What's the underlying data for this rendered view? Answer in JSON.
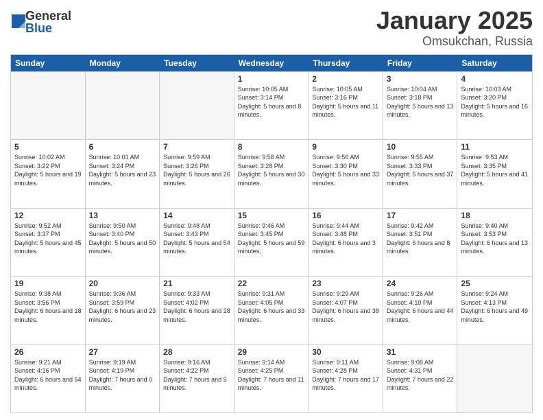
{
  "logo": {
    "general": "General",
    "blue": "Blue"
  },
  "title": "January 2025",
  "subtitle": "Omsukchan, Russia",
  "days": [
    "Sunday",
    "Monday",
    "Tuesday",
    "Wednesday",
    "Thursday",
    "Friday",
    "Saturday"
  ],
  "weeks": [
    [
      {
        "day": "",
        "empty": true
      },
      {
        "day": "",
        "empty": true
      },
      {
        "day": "",
        "empty": true
      },
      {
        "day": "1",
        "sunrise": "10:05 AM",
        "sunset": "3:14 PM",
        "daylight": "5 hours and 8 minutes."
      },
      {
        "day": "2",
        "sunrise": "10:05 AM",
        "sunset": "3:16 PM",
        "daylight": "5 hours and 11 minutes."
      },
      {
        "day": "3",
        "sunrise": "10:04 AM",
        "sunset": "3:18 PM",
        "daylight": "5 hours and 13 minutes."
      },
      {
        "day": "4",
        "sunrise": "10:03 AM",
        "sunset": "3:20 PM",
        "daylight": "5 hours and 16 minutes."
      }
    ],
    [
      {
        "day": "5",
        "sunrise": "10:02 AM",
        "sunset": "3:22 PM",
        "daylight": "5 hours and 19 minutes."
      },
      {
        "day": "6",
        "sunrise": "10:01 AM",
        "sunset": "3:24 PM",
        "daylight": "5 hours and 23 minutes."
      },
      {
        "day": "7",
        "sunrise": "9:59 AM",
        "sunset": "3:26 PM",
        "daylight": "5 hours and 26 minutes."
      },
      {
        "day": "8",
        "sunrise": "9:58 AM",
        "sunset": "3:28 PM",
        "daylight": "5 hours and 30 minutes."
      },
      {
        "day": "9",
        "sunrise": "9:56 AM",
        "sunset": "3:30 PM",
        "daylight": "5 hours and 33 minutes."
      },
      {
        "day": "10",
        "sunrise": "9:55 AM",
        "sunset": "3:33 PM",
        "daylight": "5 hours and 37 minutes."
      },
      {
        "day": "11",
        "sunrise": "9:53 AM",
        "sunset": "3:35 PM",
        "daylight": "5 hours and 41 minutes."
      }
    ],
    [
      {
        "day": "12",
        "sunrise": "9:52 AM",
        "sunset": "3:37 PM",
        "daylight": "5 hours and 45 minutes."
      },
      {
        "day": "13",
        "sunrise": "9:50 AM",
        "sunset": "3:40 PM",
        "daylight": "5 hours and 50 minutes."
      },
      {
        "day": "14",
        "sunrise": "9:48 AM",
        "sunset": "3:43 PM",
        "daylight": "5 hours and 54 minutes."
      },
      {
        "day": "15",
        "sunrise": "9:46 AM",
        "sunset": "3:45 PM",
        "daylight": "5 hours and 59 minutes."
      },
      {
        "day": "16",
        "sunrise": "9:44 AM",
        "sunset": "3:48 PM",
        "daylight": "6 hours and 3 minutes."
      },
      {
        "day": "17",
        "sunrise": "9:42 AM",
        "sunset": "3:51 PM",
        "daylight": "6 hours and 8 minutes."
      },
      {
        "day": "18",
        "sunrise": "9:40 AM",
        "sunset": "3:53 PM",
        "daylight": "6 hours and 13 minutes."
      }
    ],
    [
      {
        "day": "19",
        "sunrise": "9:38 AM",
        "sunset": "3:56 PM",
        "daylight": "6 hours and 18 minutes."
      },
      {
        "day": "20",
        "sunrise": "9:36 AM",
        "sunset": "3:59 PM",
        "daylight": "6 hours and 23 minutes."
      },
      {
        "day": "21",
        "sunrise": "9:33 AM",
        "sunset": "4:02 PM",
        "daylight": "6 hours and 28 minutes."
      },
      {
        "day": "22",
        "sunrise": "9:31 AM",
        "sunset": "4:05 PM",
        "daylight": "6 hours and 33 minutes."
      },
      {
        "day": "23",
        "sunrise": "9:29 AM",
        "sunset": "4:07 PM",
        "daylight": "6 hours and 38 minutes."
      },
      {
        "day": "24",
        "sunrise": "9:26 AM",
        "sunset": "4:10 PM",
        "daylight": "6 hours and 44 minutes."
      },
      {
        "day": "25",
        "sunrise": "9:24 AM",
        "sunset": "4:13 PM",
        "daylight": "6 hours and 49 minutes."
      }
    ],
    [
      {
        "day": "26",
        "sunrise": "9:21 AM",
        "sunset": "4:16 PM",
        "daylight": "6 hours and 54 minutes."
      },
      {
        "day": "27",
        "sunrise": "9:19 AM",
        "sunset": "4:19 PM",
        "daylight": "7 hours and 0 minutes."
      },
      {
        "day": "28",
        "sunrise": "9:16 AM",
        "sunset": "4:22 PM",
        "daylight": "7 hours and 5 minutes."
      },
      {
        "day": "29",
        "sunrise": "9:14 AM",
        "sunset": "4:25 PM",
        "daylight": "7 hours and 11 minutes."
      },
      {
        "day": "30",
        "sunrise": "9:11 AM",
        "sunset": "4:28 PM",
        "daylight": "7 hours and 17 minutes."
      },
      {
        "day": "31",
        "sunrise": "9:08 AM",
        "sunset": "4:31 PM",
        "daylight": "7 hours and 22 minutes."
      },
      {
        "day": "",
        "empty": true
      }
    ]
  ]
}
